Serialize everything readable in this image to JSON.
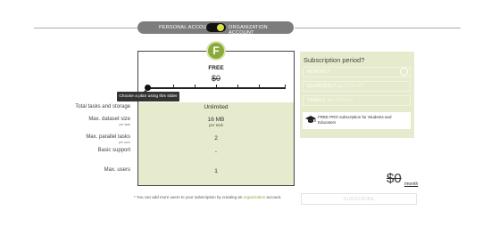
{
  "account_toggle": {
    "left_label": "PERSONAL ACCOUNT",
    "right_label": "ORGANIZATION ACCOUNT"
  },
  "plan": {
    "logo_letter": "F",
    "name": "FREE",
    "price": "$0",
    "slider_tooltip": "Choose a plan using this slider",
    "slider_position": 0
  },
  "features": [
    {
      "label": "Total tasks and storage",
      "sub": "",
      "value": "Unlimited",
      "value_sub": ""
    },
    {
      "label": "Max. dataset size",
      "sub": "per task",
      "value": "16 MB",
      "value_sub": "per task"
    },
    {
      "label": "Max. parallel tasks",
      "sub": "per user",
      "value": "2",
      "value_sub": ""
    },
    {
      "label": "Basic support",
      "sub": "",
      "value": "-",
      "value_sub": ""
    },
    {
      "label": "Max. users",
      "sub": "",
      "value": "1",
      "value_sub": ""
    }
  ],
  "subscription": {
    "title": "Subscription period?",
    "periods": [
      {
        "label": "MONTHLY",
        "discount": ""
      },
      {
        "label": "QUARTERLY",
        "discount": "get 10% off"
      },
      {
        "label": "YEARLY",
        "discount": "get 30% off"
      }
    ],
    "promo": "FREE PRO subscription for Students and Educators",
    "promo_icon": "graduation-cap-icon"
  },
  "total": {
    "price": "$0",
    "unit": "/month"
  },
  "note": {
    "before": "* You can add more users to your subscription by creating an",
    "link": "organization",
    "after": "account."
  },
  "subscribe_label": "SUBSCRIBE",
  "colors": {
    "accent_green": "#8aab3a",
    "panel_bg": "#e6ebcd",
    "toggle_knob": "#d6e34a"
  }
}
